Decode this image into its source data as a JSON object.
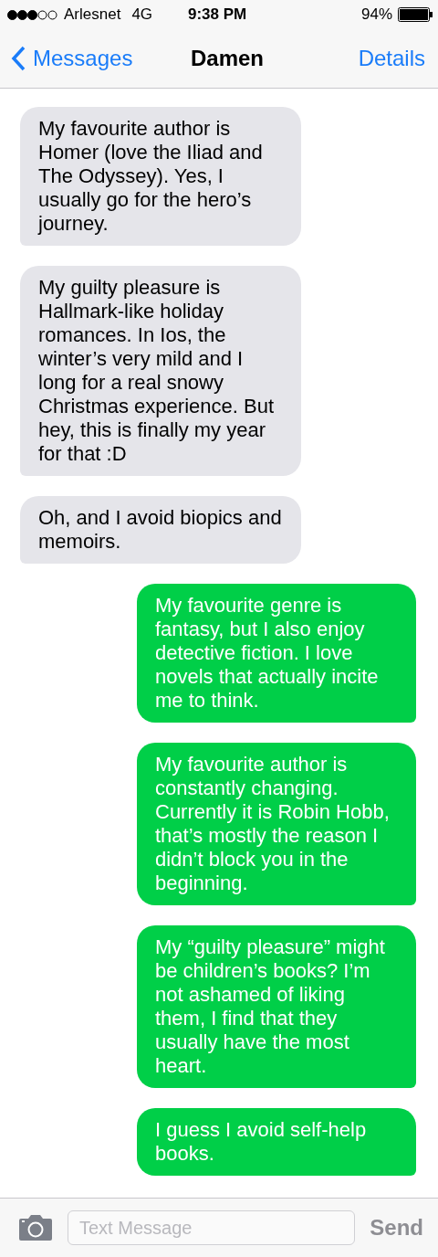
{
  "status_bar": {
    "carrier": "Arlesnet",
    "network": "4G",
    "time": "9:38 PM",
    "battery": "94%"
  },
  "nav_bar": {
    "back": "Messages",
    "title": "Damen",
    "action": "Details"
  },
  "messages": [
    {
      "kind": "incoming",
      "text": "My favourite author is Homer (love the Iliad and The Odyssey). Yes, I usually go for the hero’s journey."
    },
    {
      "kind": "incoming",
      "text": "My guilty pleasure is Hallmark-like holiday romances. In Ios, the winter’s very mild and I long for a real snowy Christmas experience. But hey, this is finally my year for that :D"
    },
    {
      "kind": "incoming",
      "text": "Oh, and I avoid biopics and memoirs."
    },
    {
      "kind": "outgoing",
      "text": "My favourite genre is fantasy, but I also enjoy detective fiction. I love novels that actually incite me to think."
    },
    {
      "kind": "outgoing",
      "text": "My favourite author is constantly changing. Currently it is Robin Hobb, that’s mostly the reason I didn’t block you in the beginning."
    },
    {
      "kind": "outgoing",
      "text": "My “guilty pleasure” might be children’s books? I’m not ashamed of liking them, I find that they usually have the most heart."
    },
    {
      "kind": "outgoing",
      "text": "I guess I avoid self-help books."
    }
  ],
  "compose": {
    "placeholder": "Text Message",
    "send": "Send"
  }
}
